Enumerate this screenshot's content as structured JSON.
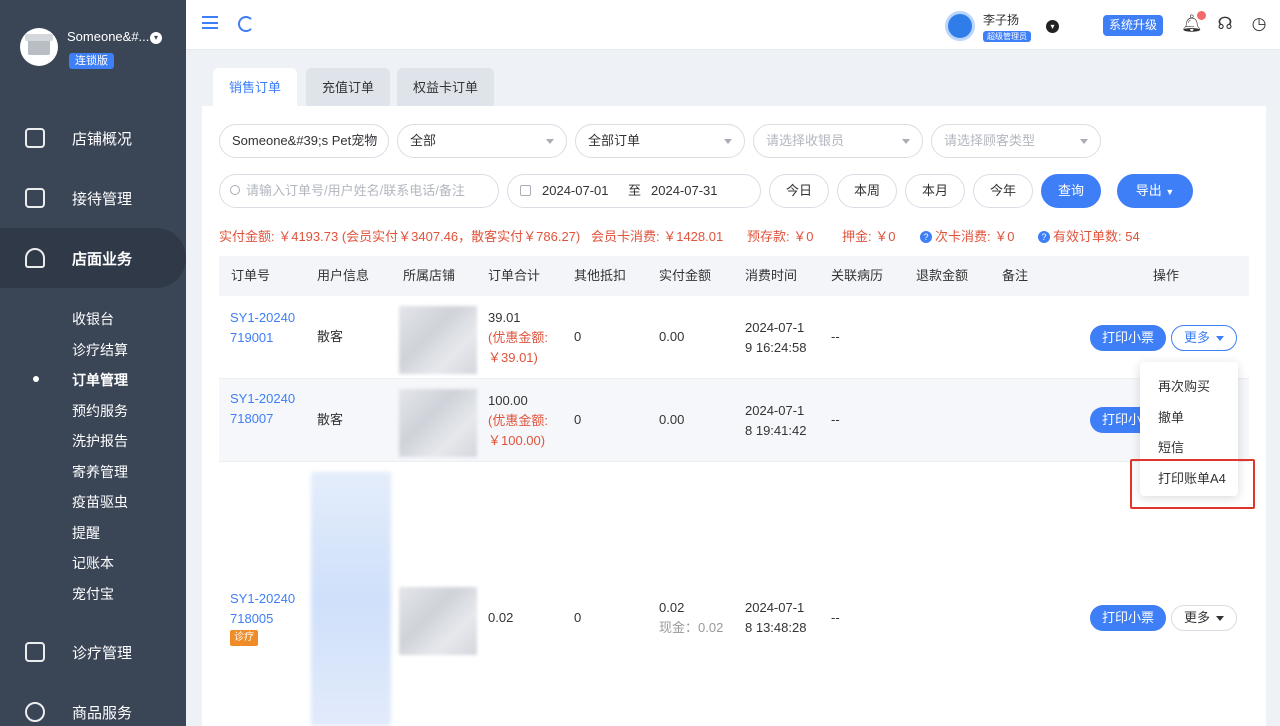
{
  "sidebar": {
    "store_name": "Someone&#...",
    "edition_badge": "连锁版",
    "nav": [
      {
        "label": "店铺概况"
      },
      {
        "label": "接待管理"
      },
      {
        "label": "店面业务"
      },
      {
        "label": "诊疗管理"
      },
      {
        "label": "商品服务"
      }
    ],
    "sub_items": [
      "收银台",
      "诊疗结算",
      "订单管理",
      "预约服务",
      "洗护报告",
      "寄养管理",
      "疫苗驱虫",
      "提醒",
      "记账本",
      "宠付宝"
    ],
    "active_sub": "订单管理"
  },
  "topbar": {
    "user_name": "李子扬",
    "user_role": "超级管理员",
    "upgrade_label": "系统升级"
  },
  "tabs": [
    {
      "label": "销售订单",
      "active": true
    },
    {
      "label": "充值订单",
      "active": false
    },
    {
      "label": "权益卡订单",
      "active": false
    }
  ],
  "filters": {
    "store_select": "Someone&#39;s Pet宠物",
    "scope_select": "全部",
    "order_type_select": "全部订单",
    "cashier_placeholder": "请选择收银员",
    "customer_type_placeholder": "请选择顾客类型",
    "search_placeholder": "请输入订单号/用户姓名/联系电话/备注",
    "date_from": "2024-07-01",
    "date_sep": "至",
    "date_to": "2024-07-31",
    "quick_today": "今日",
    "quick_week": "本周",
    "quick_month": "本月",
    "quick_year": "今年",
    "query_label": "查询",
    "export_label": "导出"
  },
  "summary": {
    "paid": "实付金额: ￥4193.73 (会员实付￥3407.46，散客实付￥786.27)",
    "member_card": "会员卡消费: ￥1428.01",
    "prepaid": "预存款: ￥0",
    "deposit": "押金: ￥0",
    "times_card": "次卡消费: ￥0",
    "valid_orders": "有效订单数: 54"
  },
  "table": {
    "headers": [
      "订单号",
      "用户信息",
      "所属店铺",
      "订单合计",
      "其他抵扣",
      "实付金额",
      "消费时间",
      "关联病历",
      "退款金额",
      "备注",
      "操作"
    ],
    "rows": [
      {
        "order_no_line1": "SY1-20240",
        "order_no_line2": "719001",
        "user": "散客",
        "total": "39.01",
        "discount_line1": "(优惠金额:",
        "discount_line2": "￥39.01)",
        "other": "0",
        "paid": "0.00",
        "time_line1": "2024-07-1",
        "time_line2": "9 16:24:58",
        "record": "--"
      },
      {
        "order_no_line1": "SY1-20240",
        "order_no_line2": "718007",
        "user": "散客",
        "total": "100.00",
        "discount_line1": "(优惠金额:",
        "discount_line2": "￥100.00)",
        "other": "0",
        "paid": "0.00",
        "time_line1": "2024-07-1",
        "time_line2": "8 19:41:42",
        "record": "--"
      },
      {
        "order_no_line1": "SY1-20240",
        "order_no_line2": "718005",
        "tag": "诊疗",
        "total": "0.02",
        "other": "0",
        "paid": "0.02",
        "paid_note": "现金：0.02",
        "time_line1": "2024-07-1",
        "time_line2": "8 13:48:28",
        "record": "--"
      }
    ],
    "print_label": "打印小票",
    "more_label": "更多"
  },
  "more_menu": [
    "再次购买",
    "撤单",
    "短信",
    "打印账单A4"
  ],
  "colors": {
    "accent": "#3e7ef7",
    "sidebar": "#3a4556",
    "summary_red": "#e0533b",
    "highlight": "#e0352b"
  }
}
